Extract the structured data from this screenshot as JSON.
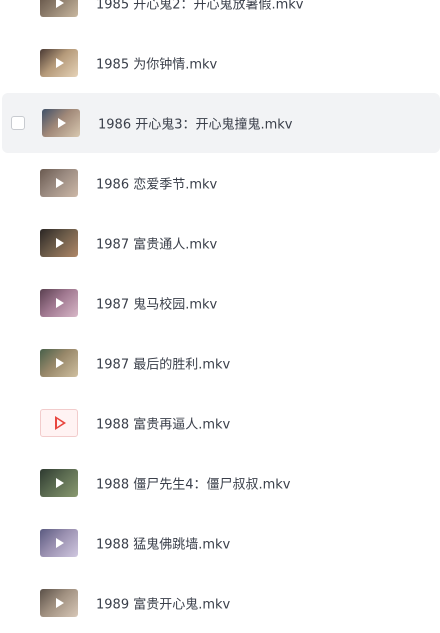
{
  "files": [
    {
      "name": "1985 开心鬼2：开心鬼放暑假.mkv",
      "thumb": "video-thumbnail",
      "colors": [
        "#5a4a3f",
        "#8b7b6a",
        "#c9b8a0"
      ]
    },
    {
      "name": "1985 为你钟情.mkv",
      "thumb": "video-thumbnail",
      "colors": [
        "#4a3a34",
        "#b59a7a",
        "#e6d3b8"
      ]
    },
    {
      "name": "1986 开心鬼3：开心鬼撞鬼.mkv",
      "thumb": "video-thumbnail",
      "colors": [
        "#3f5068",
        "#a08878",
        "#d8c8b0"
      ]
    },
    {
      "name": "1986 恋爱季节.mkv",
      "thumb": "video-thumbnail",
      "colors": [
        "#6a5a50",
        "#9a8a80",
        "#cdb9a8"
      ]
    },
    {
      "name": "1987 富贵通人.mkv",
      "thumb": "video-thumbnail",
      "colors": [
        "#2a2624",
        "#6a5a48",
        "#b08868"
      ]
    },
    {
      "name": "1987 鬼马校园.mkv",
      "thumb": "video-thumbnail",
      "colors": [
        "#5a4050",
        "#a07890",
        "#d8b8c8"
      ]
    },
    {
      "name": "1987 最后的胜利.mkv",
      "thumb": "video-thumbnail",
      "colors": [
        "#48604a",
        "#98886a",
        "#d0c0a0"
      ]
    },
    {
      "name": "1988 富贵再逼人.mkv",
      "thumb": "video-file-placeholder-icon",
      "colors": [
        "#fff3f3",
        "#fff3f3",
        "#fff3f3"
      ]
    },
    {
      "name": "1988 僵尸先生4：僵尸叔叔.mkv",
      "thumb": "video-thumbnail",
      "colors": [
        "#2e3a30",
        "#5a6a50",
        "#8a9a70"
      ]
    },
    {
      "name": "1988 猛鬼佛跳墙.mkv",
      "thumb": "video-thumbnail",
      "colors": [
        "#5a5a80",
        "#9a90b0",
        "#d0c8e0"
      ]
    },
    {
      "name": "1989 富贵开心鬼.mkv",
      "thumb": "video-thumbnail",
      "colors": [
        "#5a5048",
        "#a09080",
        "#d8c8b8"
      ]
    }
  ],
  "hovered_index": 2
}
